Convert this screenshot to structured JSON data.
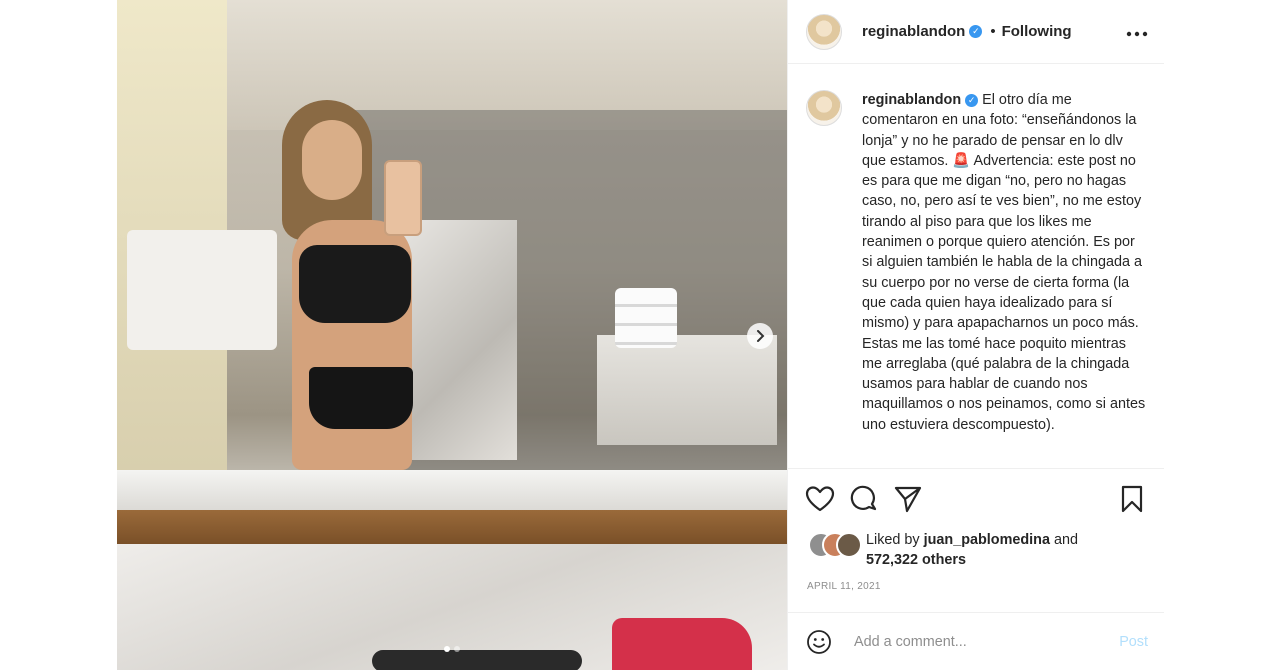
{
  "post": {
    "username": "reginablandon",
    "verified_icon": "verified-badge-icon",
    "follow_separator": "•",
    "follow_status": "Following",
    "more_label": "•••"
  },
  "caption": {
    "username": "reginablandon",
    "text": "El otro día me comentaron en una foto: “enseñándonos la lonja” y no he parado de pensar en lo dlv que estamos. 🚨 Advertencia: este post no es para que me digan “no, pero no hagas caso, no, pero así te ves bien”, no me estoy tirando al piso para que los likes me reanimen o porque quiero atención. Es por si alguien también le habla de la chingada a su cuerpo por no verse de cierta forma (la que cada quien haya idealizado para sí mismo) y para apapacharnos un poco más.\nEstas me las tomé hace poquito mientras me arreglaba (qué palabra de la chingada usamos para hablar de cuando nos maquillamos o nos peinamos, como si antes uno estuviera descompuesto)."
  },
  "likes": {
    "prefix": "Liked by",
    "user": "juan_pablomedina",
    "conjunction": "and",
    "count": "572,322 others"
  },
  "date": "APRIL 11, 2021",
  "comment": {
    "placeholder": "Add a comment...",
    "post_label": "Post"
  },
  "carousel": {
    "next_icon": "chevron-right-icon",
    "slide_count": 2,
    "active_slide": 1
  },
  "colors": {
    "verified": "#3897f0",
    "post_button_disabled": "#b2dffc",
    "secondary_text": "#8e8e8e"
  }
}
